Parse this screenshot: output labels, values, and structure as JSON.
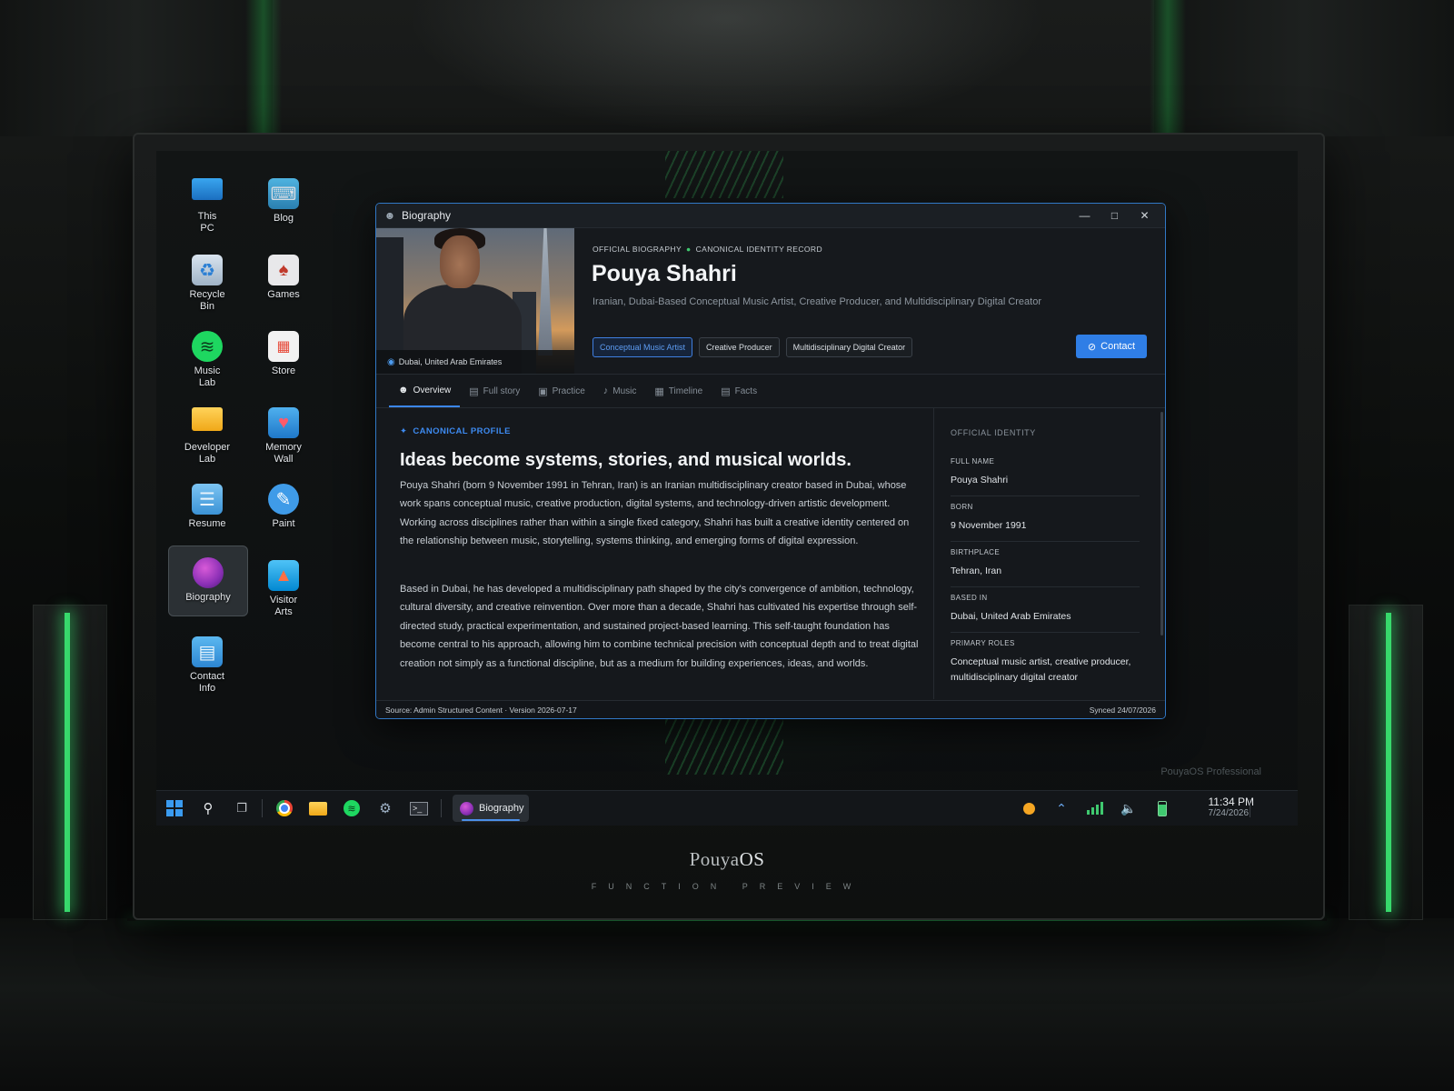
{
  "brand": {
    "name_prefix": "Pouya",
    "name_suffix": "OS",
    "tagline": "FUNCTION PREVIEW"
  },
  "desktop": {
    "watermark": "PouyaOS Professional",
    "icons": [
      {
        "label": "This\nPC",
        "icon": "monitor-icon"
      },
      {
        "label": "Blog",
        "icon": "typewriter-icon"
      },
      {
        "label": "Recycle\nBin",
        "icon": "recycle-bin-icon"
      },
      {
        "label": "Games",
        "icon": "cards-icon"
      },
      {
        "label": "Music\nLab",
        "icon": "spotify-icon"
      },
      {
        "label": "Store",
        "icon": "store-bag-icon"
      },
      {
        "label": "Developer\nLab",
        "icon": "folder-icon"
      },
      {
        "label": "Memory\nWall",
        "icon": "heart-mail-icon"
      },
      {
        "label": "Resume",
        "icon": "notepad-icon"
      },
      {
        "label": "Paint",
        "icon": "palette-icon"
      },
      {
        "label": "Biography",
        "icon": "globe-icon",
        "selected": true
      },
      {
        "label": "Visitor\nArts",
        "icon": "easel-icon"
      },
      {
        "label": "Contact\nInfo",
        "icon": "contact-card-icon"
      }
    ]
  },
  "window": {
    "title": "Biography",
    "hero": {
      "location": "Dubai, United Arab Emirates",
      "eyebrow_left": "OFFICIAL BIOGRAPHY",
      "eyebrow_right": "CANONICAL IDENTITY RECORD",
      "name": "Pouya Shahri",
      "subtitle": "Iranian, Dubai-Based Conceptual Music Artist, Creative Producer, and Multidisciplinary Digital Creator",
      "roles": [
        "Conceptual Music Artist",
        "Creative Producer",
        "Multidisciplinary Digital Creator"
      ],
      "contact_label": "Contact"
    },
    "tabs": [
      {
        "label": "Overview",
        "icon": "person-icon",
        "active": true
      },
      {
        "label": "Full story",
        "icon": "book-icon"
      },
      {
        "label": "Practice",
        "icon": "briefcase-icon"
      },
      {
        "label": "Music",
        "icon": "music-note-icon"
      },
      {
        "label": "Timeline",
        "icon": "calendar-icon"
      },
      {
        "label": "Facts",
        "icon": "document-icon"
      }
    ],
    "main": {
      "kicker": "CANONICAL PROFILE",
      "headline": "Ideas become systems, stories, and musical worlds.",
      "paragraphs": [
        "Pouya Shahri (born 9 November 1991 in Tehran, Iran) is an Iranian multidisciplinary creator based in Dubai, whose work spans conceptual music, creative production, digital systems, and technology-driven artistic development. Working across disciplines rather than within a single fixed category, Shahri has built a creative identity centered on the relationship between music, storytelling, systems thinking, and emerging forms of digital expression.",
        "Based in Dubai, he has developed a multidisciplinary path shaped by the city's convergence of ambition, technology, cultural diversity, and creative reinvention. Over more than a decade, Shahri has cultivated his expertise through self-directed study, practical experimentation, and sustained project-based learning. This self-taught foundation has become central to his approach, allowing him to combine technical precision with conceptual depth and to treat digital creation not simply as a functional discipline, but as a medium for building experiences, ideas, and worlds."
      ]
    },
    "identity": {
      "heading": "OFFICIAL IDENTITY",
      "fields": [
        {
          "key": "FULL NAME",
          "value": "Pouya Shahri"
        },
        {
          "key": "BORN",
          "value": "9 November 1991"
        },
        {
          "key": "BIRTHPLACE",
          "value": "Tehran, Iran"
        },
        {
          "key": "BASED IN",
          "value": "Dubai, United Arab Emirates"
        },
        {
          "key": "PRIMARY ROLES",
          "value": "Conceptual music artist, creative producer, multidisciplinary digital creator"
        }
      ]
    },
    "status": {
      "source": "Source: Admin Structured Content · Version 2026-07-17",
      "synced": "Synced 24/07/2026"
    }
  },
  "taskbar": {
    "active_app": "Biography",
    "time": "11:34 PM",
    "date": "7/24/2026"
  },
  "colors": {
    "accent": "#2f7ee6",
    "glow": "#38d96c",
    "window_bg": "#15181c"
  }
}
